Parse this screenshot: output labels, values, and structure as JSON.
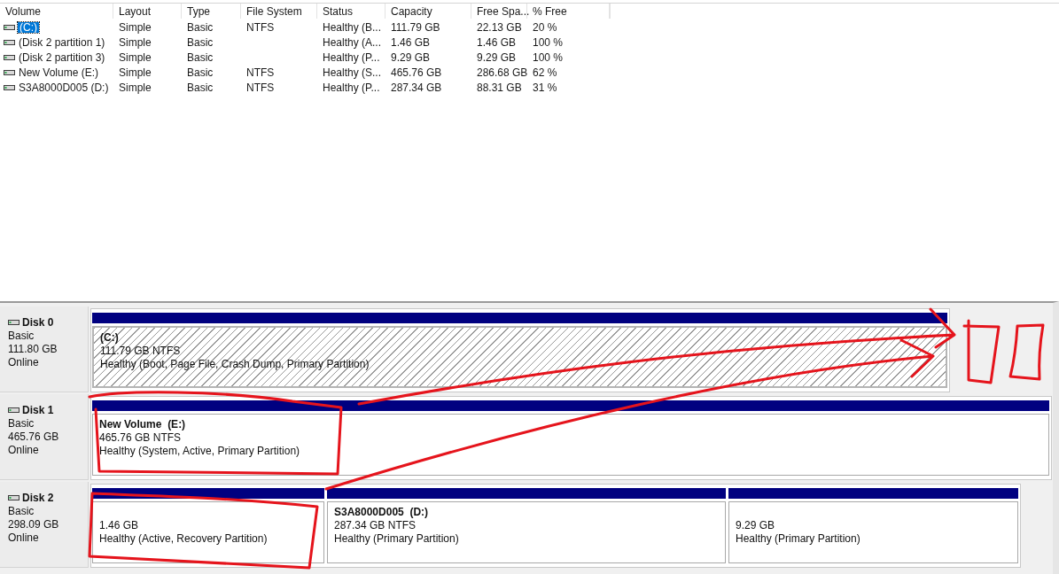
{
  "volume_list": {
    "columns": [
      "Volume",
      "Layout",
      "Type",
      "File System",
      "Status",
      "Capacity",
      "Free Spa...",
      "% Free"
    ],
    "rows": [
      {
        "selected": true,
        "volume": "(C:)",
        "layout": "Simple",
        "type": "Basic",
        "file_system": "NTFS",
        "status": "Healthy (B...",
        "capacity": "111.79 GB",
        "free_space": "22.13 GB",
        "percent_free": "20 %"
      },
      {
        "selected": false,
        "volume": "(Disk 2 partition 1)",
        "layout": "Simple",
        "type": "Basic",
        "status": "Healthy (A...",
        "capacity": "1.46 GB",
        "free_space": "1.46 GB",
        "percent_free": "100 %"
      },
      {
        "selected": false,
        "volume": "(Disk 2 partition 3)",
        "layout": "Simple",
        "type": "Basic",
        "status": "Healthy (P...",
        "capacity": "9.29 GB",
        "free_space": "9.29 GB",
        "percent_free": "100 %"
      },
      {
        "selected": false,
        "volume": "New Volume (E:)",
        "layout": "Simple",
        "type": "Basic",
        "file_system": "NTFS",
        "status": "Healthy (S...",
        "capacity": "465.76 GB",
        "free_space": "286.68 GB",
        "percent_free": "62 %"
      },
      {
        "selected": false,
        "volume": "S3A8000D005 (D:)",
        "layout": "Simple",
        "type": "Basic",
        "file_system": "NTFS",
        "status": "Healthy (P...",
        "capacity": "287.34 GB",
        "free_space": "88.31 GB",
        "percent_free": "31 %"
      }
    ]
  },
  "disks": [
    {
      "name": "Disk 0",
      "type": "Basic",
      "size": "111.80 GB",
      "status": "Online",
      "partitions": [
        {
          "selected": true,
          "title": "(C:)",
          "size": "111.79 GB NTFS",
          "status": "Healthy (Boot, Page File, Crash Dump, Primary Partition)"
        }
      ]
    },
    {
      "name": "Disk 1",
      "type": "Basic",
      "size": "465.76 GB",
      "status": "Online",
      "partitions": [
        {
          "selected": false,
          "title": "New Volume  (E:)",
          "size": "465.76 GB NTFS",
          "status": "Healthy (System, Active, Primary Partition)"
        }
      ]
    },
    {
      "name": "Disk 2",
      "type": "Basic",
      "size": "298.09 GB",
      "status": "Online",
      "partitions": [
        {
          "selected": false,
          "size": "1.46 GB",
          "status": "Healthy (Active, Recovery Partition)"
        },
        {
          "selected": false,
          "title": "S3A8000D005  (D:)",
          "size": "287.34 GB NTFS",
          "status": "Healthy (Primary Partition)"
        },
        {
          "selected": false,
          "size": "9.29 GB",
          "status": "Healthy (Primary Partition)"
        }
      ]
    }
  ]
}
